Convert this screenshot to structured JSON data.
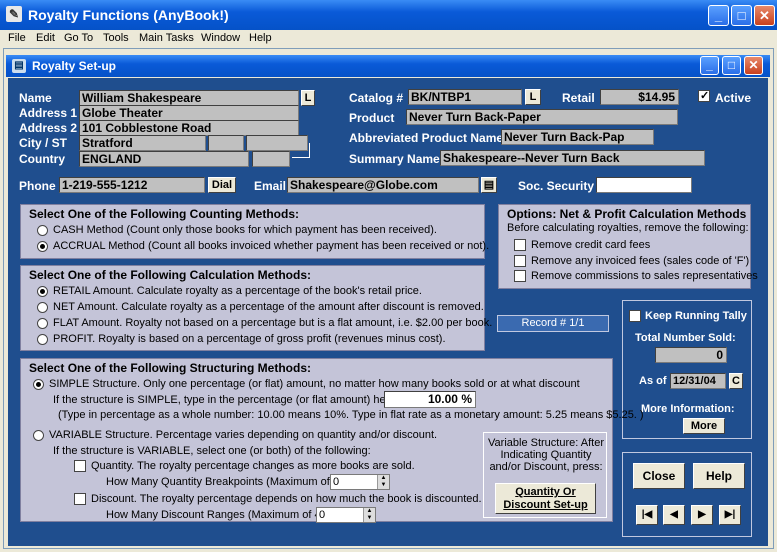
{
  "window": {
    "title": "Royalty Functions (AnyBook!)",
    "app_icon": "pen-icon"
  },
  "menu": [
    "File",
    "Edit",
    "Go To",
    "Tools",
    "Main Tasks",
    "Window",
    "Help"
  ],
  "child": {
    "title": "Royalty Set-up"
  },
  "author": {
    "name_label": "Name",
    "name": "William Shakespeare",
    "l_button": "L",
    "address1_label": "Address 1",
    "address1": "Globe Theater",
    "address2_label": "Address 2",
    "address2": "101 Cobblestone Road",
    "city_label": "City / ST",
    "city": "Stratford",
    "country_label": "Country",
    "country": "ENGLAND",
    "phone_label": "Phone",
    "phone": "1-219-555-1212",
    "dial": "Dial",
    "email_label": "Email",
    "email": "Shakespeare@Globe.com",
    "ssn_label": "Soc. Security",
    "ssn": ""
  },
  "product": {
    "catalog_label": "Catalog #",
    "catalog": "BK/NTBP1",
    "l_button": "L",
    "retail_label": "Retail",
    "retail": "$14.95",
    "active_label": "Active",
    "product_label": "Product",
    "product": "Never Turn Back-Paper",
    "abbrev_label": "Abbreviated Product Name",
    "abbrev": "Never Turn Back-Pap",
    "summary_label": "Summary Name",
    "summary": "Shakespeare--Never Turn Back"
  },
  "counting": {
    "title": "Select One of the Following Counting Methods:",
    "options": [
      "CASH Method (Count only those books for which payment has been received).",
      "ACCRUAL Method (Count all books invoiced whether payment has been received or not)."
    ]
  },
  "options": {
    "title": "Options: Net & Profit Calculation Methods",
    "intro": "Before calculating royalties, remove the following:",
    "items": [
      "Remove credit card fees",
      "Remove any invoiced fees (sales code of 'F')",
      "Remove commissions to sales representatives"
    ]
  },
  "calculation": {
    "title": "Select One of the Following Calculation Methods:",
    "options": [
      "RETAIL Amount.  Calculate royalty as a percentage of the book's retail price.",
      "NET Amount.  Calculate royalty as a percentage of the amount after discount is removed.",
      "FLAT Amount.  Royalty not based on a percentage but is a flat amount, i.e. $2.00 per book.",
      "PROFIT.  Royalty is based on a percentage of gross profit (revenues minus cost)."
    ]
  },
  "record": "Record # 1/1",
  "tally": {
    "keep_label": "Keep Running Tally",
    "total_label": "Total Number Sold:",
    "total": "0",
    "asof_label": "As of",
    "asof": "12/31/04",
    "c_button": "C",
    "more_info_label": "More Information:",
    "more_button": "More"
  },
  "structuring": {
    "title": "Select One of the Following Structuring Methods:",
    "simple": "SIMPLE Structure.  Only one percentage (or flat) amount, no matter how many books sold or at what discount",
    "simple_hint": "If the structure is SIMPLE, type in the percentage (or flat amount) here --->",
    "percent": "10.00 %",
    "simple_note": "(Type in percentage as a whole number: 10.00 means 10%.  Type in flat rate as a monetary amount: 5.25 means $5.25. )",
    "variable": "VARIABLE Structure.  Percentage varies depending on quantity and/or discount.",
    "variable_hint": "If the structure is VARIABLE, select one (or both) of the following:",
    "quantity": "Quantity.  The royalty percentage changes as more books are sold.",
    "quantity_bp": "How Many Quantity Breakpoints (Maximum of 5):",
    "quantity_val": "0",
    "discount": "Discount.  The royalty percentage depends on how much the book is discounted.",
    "discount_ranges": "How Many Discount Ranges (Maximum of 4):",
    "discount_val": "0",
    "variable_box": "Variable Structure: After Indicating Quantity and/or Discount, press:",
    "qd_button": "Quantity Or Discount Set-up"
  },
  "actions": {
    "close": "Close",
    "help": "Help",
    "nav": [
      "|◀",
      "◀",
      "▶",
      "▶|"
    ]
  }
}
